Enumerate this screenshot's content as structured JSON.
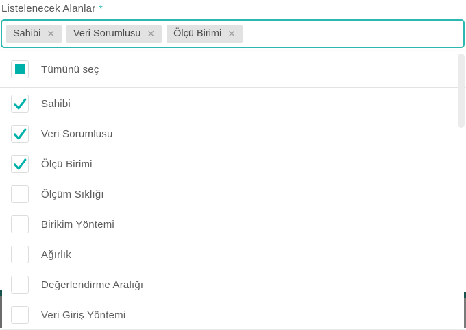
{
  "field": {
    "label": "Listelenecek Alanlar",
    "required_marker": "*",
    "chips": [
      {
        "label": "Sahibi"
      },
      {
        "label": "Veri Sorumlusu"
      },
      {
        "label": "Ölçü Birimi"
      }
    ],
    "remove_icon": "✕"
  },
  "dropdown": {
    "select_all": {
      "label": "Tümünü seç",
      "state": "all-visible-selected"
    },
    "options": [
      {
        "label": "Sahibi",
        "checked": true
      },
      {
        "label": "Veri Sorumlusu",
        "checked": true
      },
      {
        "label": "Ölçü Birimi",
        "checked": true
      },
      {
        "label": "Ölçüm Sıklığı",
        "checked": false
      },
      {
        "label": "Birikim Yöntemi",
        "checked": false
      },
      {
        "label": "Ağırlık",
        "checked": false
      },
      {
        "label": "Değerlendirme Aralığı",
        "checked": false
      },
      {
        "label": "Veri Giriş Yöntemi",
        "checked": false
      }
    ]
  },
  "colors": {
    "accent": "#00b1a9",
    "input_border": "#2cb8b1",
    "required_marker": "#2fbcb6",
    "chip_background": "#e2e2e2",
    "chip_text": "#4c4c4c",
    "chip_remove_icon": "#9e9e9e",
    "option_text": "#5d5d5d",
    "checkbox_border": "#dddddd",
    "divider": "#e4e4e4",
    "scroll_thumb": "#ebebeb",
    "page_edge_teal": "#19514c",
    "page_edge_gray": "#6b6b6b"
  }
}
